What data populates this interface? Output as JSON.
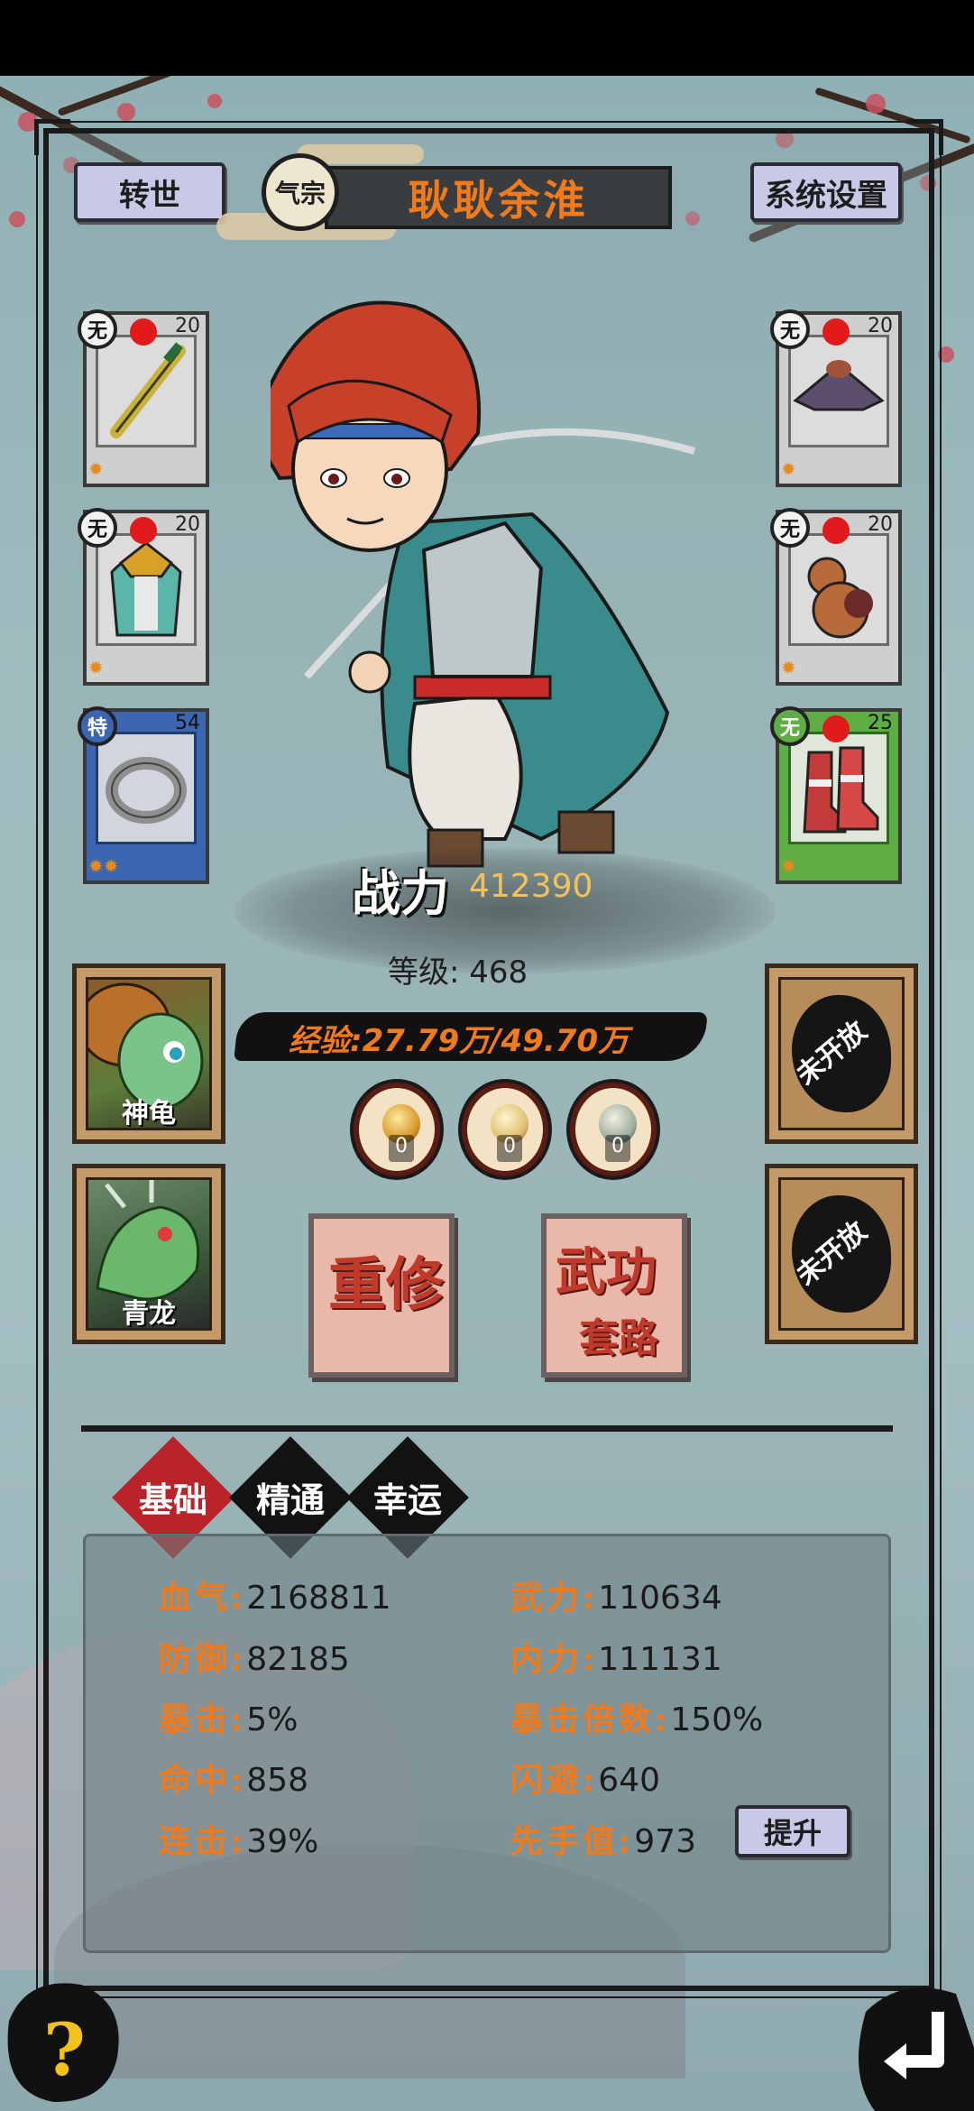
{
  "header": {
    "rebirth_label": "转世",
    "settings_label": "系统设置",
    "sect_badge": "气宗",
    "player_name": "耿耿余淮"
  },
  "equipment": {
    "left": [
      {
        "quality": "无",
        "level": "20",
        "item": "sword",
        "red_dot": true
      },
      {
        "quality": "无",
        "level": "20",
        "item": "armor",
        "red_dot": true
      },
      {
        "quality": "特",
        "level": "54",
        "item": "ring",
        "red_dot": false
      }
    ],
    "right": [
      {
        "quality": "无",
        "level": "20",
        "item": "hat",
        "red_dot": true
      },
      {
        "quality": "无",
        "level": "20",
        "item": "gourd",
        "red_dot": true
      },
      {
        "quality": "无",
        "level": "25",
        "item": "boots",
        "red_dot": true
      }
    ]
  },
  "power": {
    "label": "战力",
    "value": "412390"
  },
  "level": {
    "text": "等级: 468"
  },
  "experience": {
    "text": "经验:27.79万/49.70万"
  },
  "pets": [
    {
      "name": "神龟"
    },
    {
      "name": "青龙"
    }
  ],
  "locked_slots": [
    "未开放",
    "未开放"
  ],
  "gems": [
    {
      "count": "0"
    },
    {
      "count": "0"
    },
    {
      "count": "0"
    }
  ],
  "actions": {
    "retrain": "重修",
    "martial_line1": "武功",
    "martial_line2": "套路"
  },
  "tabs": [
    "基础",
    "精通",
    "幸运"
  ],
  "stats": {
    "hp_k": "血气:",
    "hp_v": "2168811",
    "atk_k": "武力:",
    "atk_v": "110634",
    "def_k": "防御:",
    "def_v": "82185",
    "inner_k": "内力:",
    "inner_v": "111131",
    "crit_k": "暴击:",
    "crit_v": "5%",
    "critmul_k": "暴击倍数:",
    "critmul_v": "150%",
    "hit_k": "命中:",
    "hit_v": "858",
    "dodge_k": "闪避:",
    "dodge_v": "640",
    "combo_k": "连击:",
    "combo_v": "39%",
    "init_k": "先手值:",
    "init_v": "973"
  },
  "upgrade_label": "提升",
  "colors": {
    "accent_orange": "#f07a1c",
    "gold": "#f3c25a",
    "tab_active": "#b8242a"
  }
}
